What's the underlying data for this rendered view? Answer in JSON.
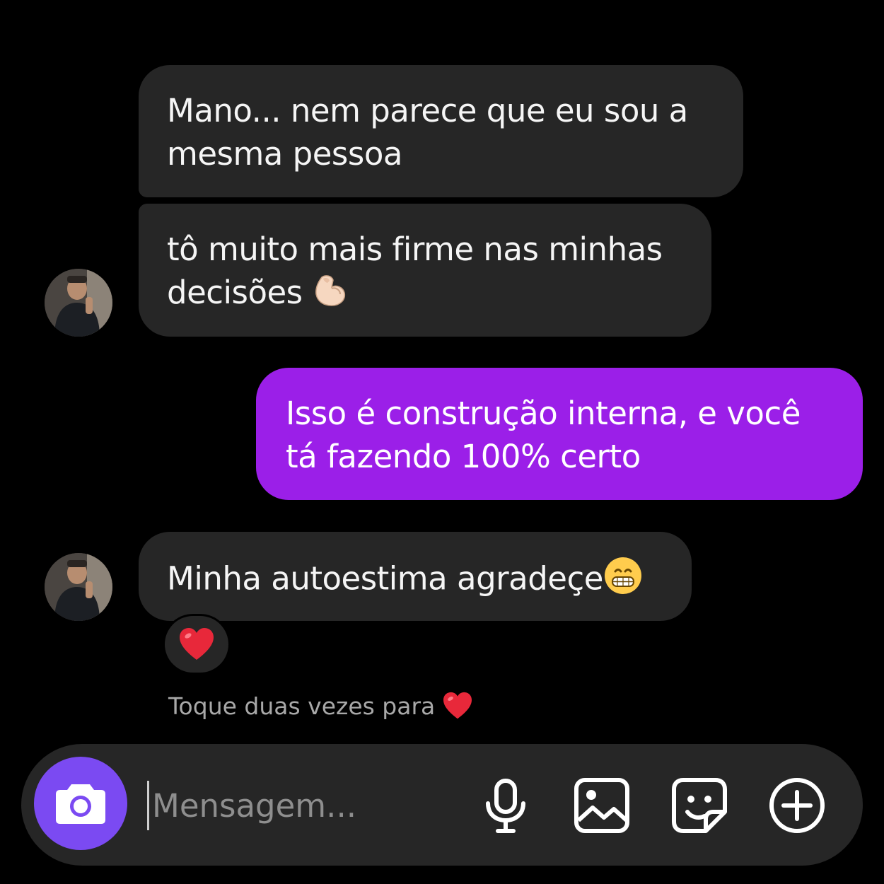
{
  "conversation": {
    "messages": [
      {
        "sender": "them",
        "text": "Mano... nem parece que eu sou a mesma pessoa"
      },
      {
        "sender": "them",
        "text": "tô muito mais firme nas minhas decisões",
        "emoji": "flexed-biceps"
      },
      {
        "sender": "me",
        "text": "Isso é construção interna, e você tá fazendo 100% certo"
      },
      {
        "sender": "them",
        "text": "Minha autoestima agradeçe",
        "emoji": "grinning-face",
        "reaction": "red-heart"
      }
    ],
    "hint": "Toque duas vezes para"
  },
  "composer": {
    "placeholder": "Mensagem...",
    "value": ""
  },
  "colors": {
    "background": "#000000",
    "incoming_bubble": "#262626",
    "outgoing_bubble": "#9b1fe8",
    "camera_button": "#7b4af2",
    "hint_text": "#a8a8a8"
  },
  "icons": [
    "camera-icon",
    "microphone-icon",
    "gallery-icon",
    "sticker-icon",
    "add-icon",
    "red-heart-icon",
    "flexed-biceps-emoji",
    "grinning-face-emoji"
  ]
}
